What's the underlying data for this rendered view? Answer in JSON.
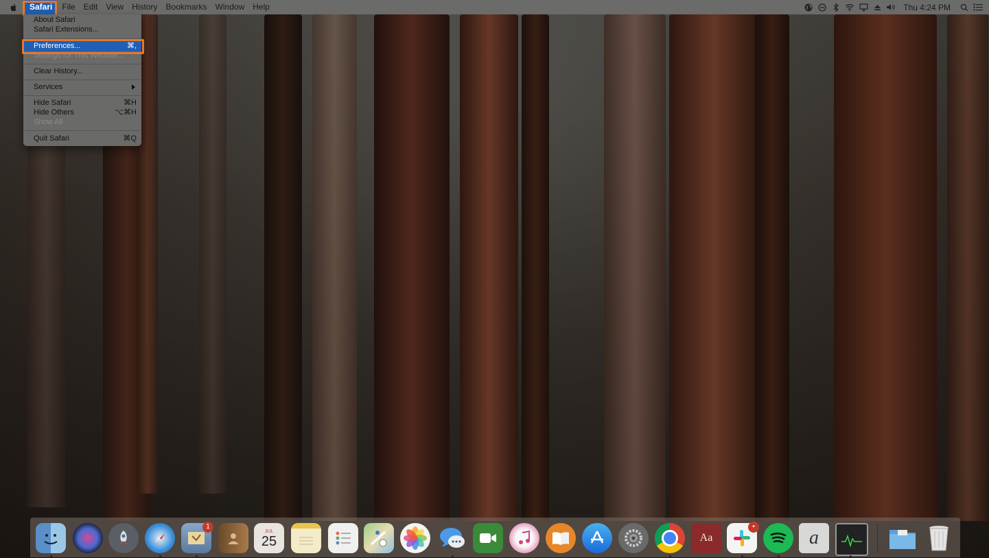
{
  "menubar": {
    "app_name": "Safari",
    "menus": [
      "File",
      "Edit",
      "View",
      "History",
      "Bookmarks",
      "Window",
      "Help"
    ],
    "clock": "Thu 4:24 PM"
  },
  "dropdown": {
    "items": [
      {
        "label": "About Safari",
        "shortcut": "",
        "state": "normal"
      },
      {
        "label": "Safari Extensions...",
        "shortcut": "",
        "state": "normal"
      },
      {
        "label": "Preferences...",
        "shortcut": "⌘,",
        "state": "selected"
      },
      {
        "label": "Settings for This Website...",
        "shortcut": "",
        "state": "disabled"
      },
      {
        "label": "Clear History...",
        "shortcut": "",
        "state": "normal"
      },
      {
        "label": "Services",
        "shortcut": "",
        "state": "submenu"
      },
      {
        "label": "Hide Safari",
        "shortcut": "⌘H",
        "state": "normal"
      },
      {
        "label": "Hide Others",
        "shortcut": "⌥⌘H",
        "state": "normal"
      },
      {
        "label": "Show All",
        "shortcut": "",
        "state": "disabled"
      },
      {
        "label": "Quit Safari",
        "shortcut": "⌘Q",
        "state": "normal"
      }
    ]
  },
  "dock": {
    "apps": [
      {
        "name": "finder-icon"
      },
      {
        "name": "siri-icon"
      },
      {
        "name": "launchpad-icon"
      },
      {
        "name": "safari-icon"
      },
      {
        "name": "mail-icon",
        "badge": "1"
      },
      {
        "name": "contacts-icon"
      },
      {
        "name": "calendar-icon",
        "month": "JUL",
        "day": "25"
      },
      {
        "name": "notes-icon"
      },
      {
        "name": "reminders-icon"
      },
      {
        "name": "maps-icon"
      },
      {
        "name": "photos-icon"
      },
      {
        "name": "messages-icon"
      },
      {
        "name": "facetime-icon"
      },
      {
        "name": "itunes-icon"
      },
      {
        "name": "books-icon"
      },
      {
        "name": "app-store-icon"
      },
      {
        "name": "system-preferences-icon"
      },
      {
        "name": "chrome-icon"
      },
      {
        "name": "dictionary-icon",
        "glyph": "Aa"
      },
      {
        "name": "slack-icon",
        "badge": "•"
      },
      {
        "name": "spotify-icon"
      },
      {
        "name": "script-editor-icon",
        "glyph": "a"
      },
      {
        "name": "activity-monitor-icon"
      },
      {
        "name": "downloads-folder-icon"
      },
      {
        "name": "trash-icon"
      }
    ]
  },
  "colors": {
    "highlight": "#1f5fb6",
    "annotation_box": "#e8762b",
    "menubar_bg": "#6b6b69"
  }
}
